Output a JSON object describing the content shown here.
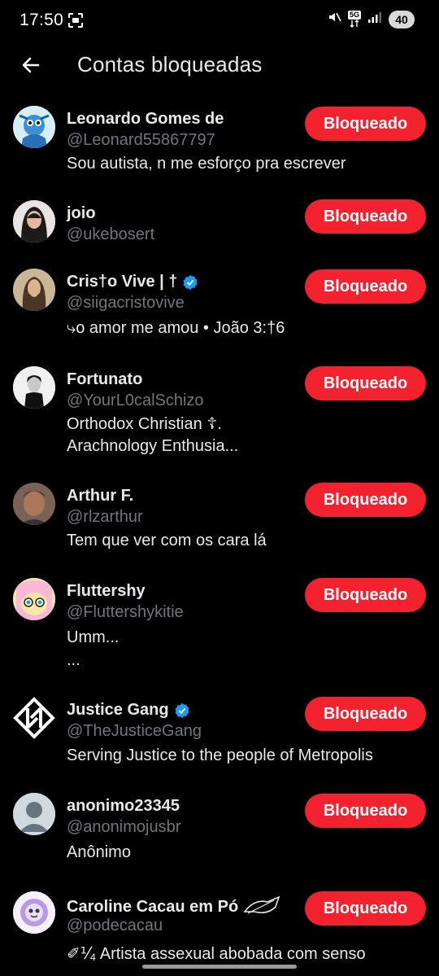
{
  "status_bar": {
    "time": "17:50",
    "battery": "40",
    "network": "5G"
  },
  "header": {
    "title": "Contas bloqueadas"
  },
  "block_label": "Bloqueado",
  "accounts": [
    {
      "name": "Leonardo Gomes de",
      "handle": "@Leonard55867797",
      "bio1": "Sou autista, n me esforço pra escrever",
      "bio2": ""
    },
    {
      "name": "joio",
      "handle": "@ukebosert",
      "bio1": "",
      "bio2": ""
    },
    {
      "name": "Cris†o Vive | †",
      "handle": "@siigacristovive",
      "bio1": "⤷o amor me amou • João 3:†6",
      "bio2": ""
    },
    {
      "name": "Fortunato",
      "handle": "@YourL0calSchizo",
      "bio1": "Orthodox Christian ☦.",
      "bio2": "Arachnology Enthusia..."
    },
    {
      "name": "Arthur F.",
      "handle": "@rlzarthur",
      "bio1": "Tem que ver com os cara lá",
      "bio2": ""
    },
    {
      "name": "Fluttershy",
      "handle": "@Fluttershykitie",
      "bio1": "Umm...",
      "bio2": "..."
    },
    {
      "name": "Justice Gang",
      "handle": "@TheJusticeGang",
      "bio1": "Serving Justice to the people of Metropolis",
      "bio2": ""
    },
    {
      "name": "anonimo23345",
      "handle": "@anonimojusbr",
      "bio1": "Anônimo",
      "bio2": ""
    },
    {
      "name": "Caroline Cacau em Pó",
      "handle": "@podecacau",
      "bio1": "✐⅟₄ Artista assexual abobada com senso",
      "bio2": ""
    }
  ]
}
